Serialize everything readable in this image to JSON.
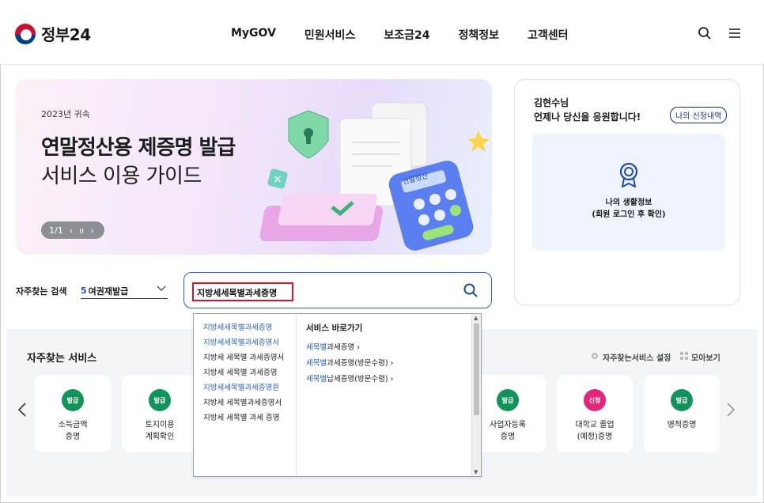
{
  "header": {
    "logo_text": "정부24",
    "nav": [
      "MyGOV",
      "민원서비스",
      "보조금24",
      "정책정보",
      "고객센터"
    ],
    "search_icon": "search-icon",
    "menu_icon": "hamburger-menu-icon"
  },
  "banner": {
    "year": "2023년 귀속",
    "title1": "연말정산용 제증명 발급",
    "title2": "서비스 이용 가이드",
    "pager": "1/1",
    "art_label": "연말정산"
  },
  "user_card": {
    "greeting1": "김현수님",
    "greeting2": "언제나 당신을 응원합니다!",
    "history_button": "나의 신청내역",
    "info_line1": "나의 생활정보",
    "info_line2": "(회원 로그인 후 확인)"
  },
  "search": {
    "label": "자주찾는 검색",
    "select_rank": "5",
    "select_text": "여권재발급",
    "input_value": "지방세세목별과세증명"
  },
  "services": {
    "title": "자주찾는 서비스",
    "settings_label": "자주찾는서비스 설정",
    "view_all_label": "모아보기",
    "cards": [
      {
        "badge": "발급",
        "line1": "소득금액",
        "line2": "증명",
        "color": "green"
      },
      {
        "badge": "발급",
        "line1": "토지이용",
        "line2": "계획확인",
        "color": "green"
      },
      {
        "badge": "발급",
        "line1": "사업자등록",
        "line2": "증명",
        "color": "green"
      },
      {
        "badge": "신청",
        "line1": "대학교 졸업",
        "line2": "(예정)증명",
        "color": "pink"
      },
      {
        "badge": "발급",
        "line1": "병적증명",
        "line2": "",
        "color": "green"
      }
    ]
  },
  "autocomplete": {
    "suggestions": [
      {
        "text": "지방세세목별과세증명",
        "highlight": true
      },
      {
        "text": "지방세세목별과세증명서",
        "highlight": true
      },
      {
        "text": "지방세 세목별 과세증명서",
        "highlight": false
      },
      {
        "text": "지방세 세목별 과세증명",
        "highlight": false
      },
      {
        "text": "지방세세목별과세증명원",
        "highlight": true
      },
      {
        "text": "지방세 세목별과세증명서",
        "highlight": false
      },
      {
        "text": "지방세 세목별 과세 증명",
        "highlight": false
      }
    ],
    "shortcut_title": "서비스 바로가기",
    "shortcuts": [
      {
        "kw": "세목별",
        "rest": "과세증명 ›"
      },
      {
        "kw": "세목별",
        "rest": "과세증명(방문수령) ›"
      },
      {
        "kw": "세목별",
        "rest": "납세증명(방문수령) ›"
      }
    ]
  }
}
